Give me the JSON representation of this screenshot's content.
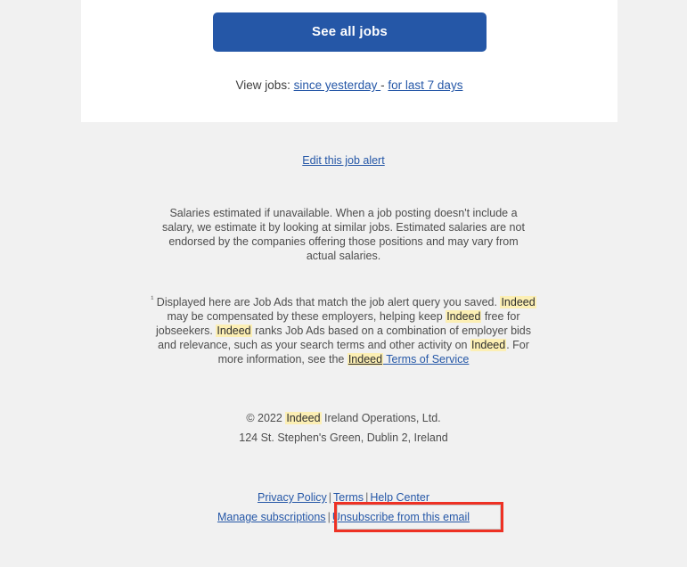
{
  "card": {
    "cta_label": "See all jobs",
    "view_jobs_prefix": "View jobs:",
    "view_jobs_link_1": "since yesterday ",
    "view_jobs_dash": "-",
    "view_jobs_link_2": "for last 7 days"
  },
  "edit_alert": {
    "label": "Edit this job alert"
  },
  "salary_note": {
    "text": "Salaries estimated if unavailable. When a job posting doesn't include a salary, we estimate it by looking at similar jobs. Estimated salaries are not endorsed by the companies offering those positions and may vary from actual salaries."
  },
  "job_ads_note": {
    "marker": "¹",
    "part_1": " Displayed here are Job Ads that match the job alert query you saved. ",
    "brand_1": "Indeed",
    "part_2": " may be compensated by these employers, helping keep ",
    "brand_2": "Indeed",
    "part_3": " free for jobseekers. ",
    "brand_3": "Indeed",
    "part_4": " ranks Job Ads based on a combination of employer bids and relevance, such as your search terms and other activity on ",
    "brand_4": "Indeed",
    "part_5": ". For more information, see the ",
    "brand_5": "Indeed",
    "terms_link": " Terms of Service"
  },
  "copyright": {
    "prefix": "© 2022 ",
    "brand": "Indeed",
    "suffix": " Ireland Operations, Ltd.",
    "address": "124 St. Stephen's Green, Dublin 2, Ireland"
  },
  "footer": {
    "privacy_policy": "Privacy Policy",
    "terms": "Terms",
    "help_center": "Help Center",
    "manage_subscriptions": "Manage subscriptions",
    "unsubscribe": "Unsubscribe from this email",
    "separator": "|"
  },
  "colors": {
    "page_background": "#f1f1f1",
    "card_background": "#ffffff",
    "brand_blue": "#2557a7",
    "link_blue": "#2557a7",
    "highlight_yellow": "#fcefb4",
    "annotation_red": "#ee3124",
    "body_text": "#4d4d4d"
  }
}
